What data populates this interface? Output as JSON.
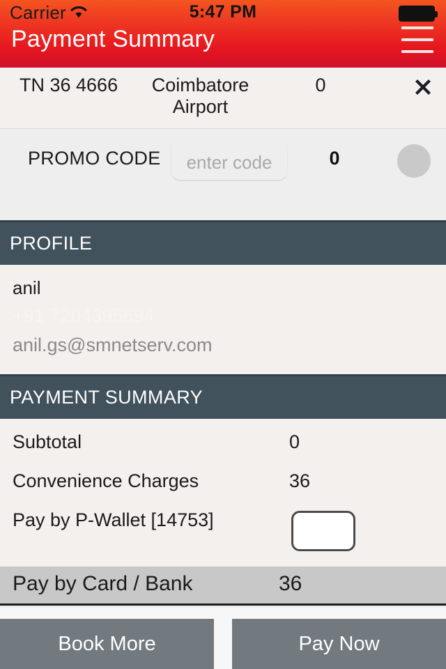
{
  "status_bar": {
    "carrier": "Carrier",
    "time": "5:47 PM",
    "wifi_icon": "wifi-icon",
    "battery_icon": "battery-full-icon"
  },
  "header": {
    "title": "Payment Summary",
    "menu_icon": "hamburger-menu-icon",
    "accent_color": "#ef3a23",
    "accent_color_bottom": "#cf0f2c"
  },
  "trip": {
    "vehicle": "TN 36 4666",
    "location": "Coimbatore Airport",
    "amount": "0",
    "close_icon": "close-x-icon"
  },
  "promo": {
    "label": "PROMO CODE",
    "placeholder": "enter code",
    "value": "",
    "amount": "0",
    "apply_button_label": ""
  },
  "profile": {
    "section_title": "PROFILE",
    "name": "anil",
    "phone": "+91 7204395694",
    "email": "anil.gs@smnetserv.com"
  },
  "payment_summary": {
    "section_title": "PAYMENT SUMMARY",
    "rows": [
      {
        "label": "Subtotal",
        "value": "0"
      },
      {
        "label": "Convenience Charges",
        "value": "36"
      },
      {
        "label": "Pay by P-Wallet [14753]",
        "value": ""
      }
    ],
    "total": {
      "label": "Pay by Card / Bank",
      "value": "36"
    }
  },
  "footer": {
    "book_more_label": "Book More",
    "pay_now_label": "Pay Now",
    "button_color": "#72797f"
  },
  "colors": {
    "section_header_bg": "#41525c",
    "panel_bg": "#f4f0ee",
    "page_bg": "#eeeeee",
    "total_band_bg": "#c8c8c8"
  }
}
